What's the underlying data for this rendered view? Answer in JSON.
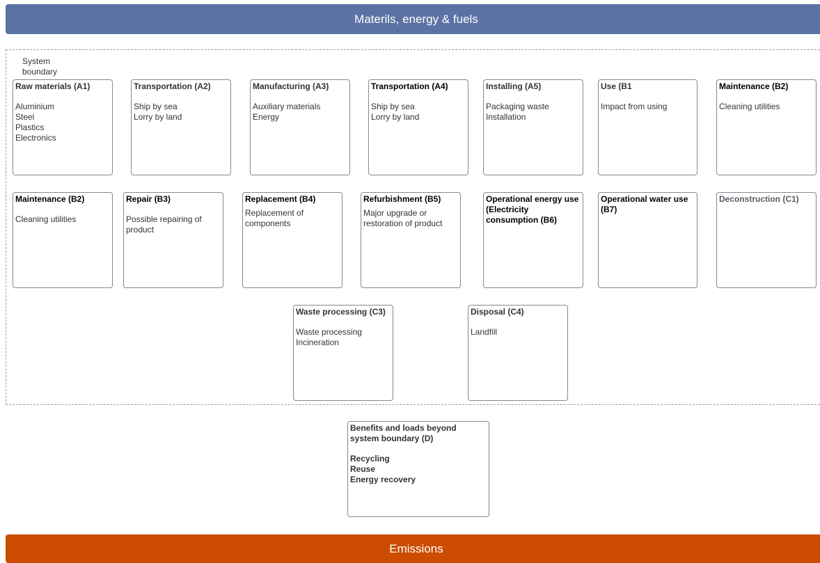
{
  "top_banner": "Materils, energy & fuels",
  "bottom_banner": "Emissions",
  "boundary_label": "System boundary",
  "row1": [
    {
      "title": "Raw materials (A1)",
      "lines": [
        "Aluminium",
        "Steel",
        "Plastics",
        "Electronics"
      ]
    },
    {
      "title": "Transportation (A2)",
      "lines": [
        "Ship by sea",
        "Lorry by land"
      ]
    },
    {
      "title": "Manufacturing (A3)",
      "lines": [
        "Auxiliary materials",
        "Energy"
      ]
    },
    {
      "title": "Transportation (A4)",
      "lines": [
        "Ship by sea",
        "Lorry by land"
      ]
    },
    {
      "title": "Installing (A5)",
      "lines": [
        "Packaging waste",
        "Installation"
      ]
    },
    {
      "title": "Use (B1",
      "lines": [
        "Impact from using"
      ]
    },
    {
      "title": "Maintenance (B2)",
      "lines": [
        "Cleaning utilities"
      ]
    }
  ],
  "row2": [
    {
      "title": "Maintenance (B2)",
      "lines": [
        "Cleaning utilities"
      ]
    },
    {
      "title": "Repair (B3)",
      "lines": [
        "Possible repairing of product"
      ]
    },
    {
      "title": "Replacement (B4)",
      "lines": [
        "Replacement of components"
      ]
    },
    {
      "title": "Refurbishment (B5)",
      "lines": [
        "Major upgrade or restoration of product"
      ]
    },
    {
      "title": "Operational energy use (Electricity consumption (B6)",
      "lines": []
    },
    {
      "title": "Operational water use (B7)",
      "lines": []
    },
    {
      "title": "Deconstruction (C1)",
      "lines": []
    }
  ],
  "row3": [
    {
      "title": "Waste processing (C3)",
      "lines": [
        "Waste processing",
        "Incineration"
      ]
    },
    {
      "title": "Disposal (C4)",
      "lines": [
        "Landfill"
      ]
    }
  ],
  "beyond": {
    "title": "Benefits and loads beyond system boundary (D)",
    "lines": [
      "Recycling",
      "Reuse",
      "Energy recovery"
    ]
  }
}
